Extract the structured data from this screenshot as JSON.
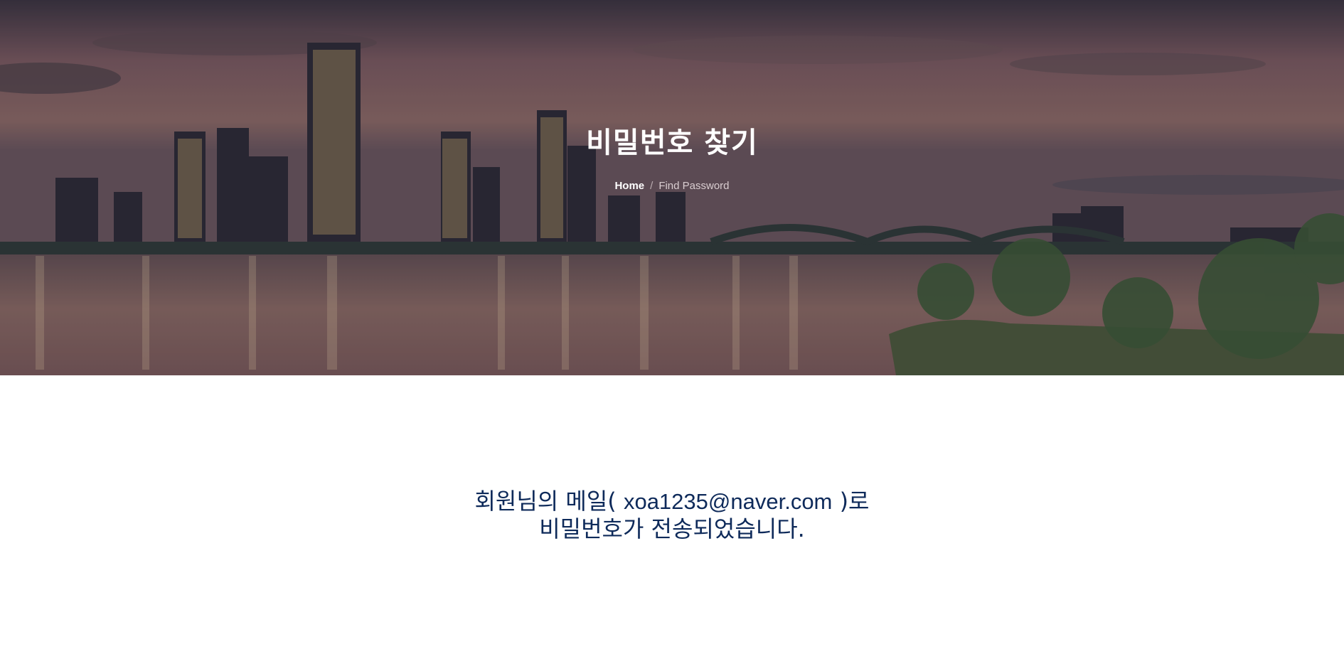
{
  "hero": {
    "title": "비밀번호 찾기",
    "breadcrumb": {
      "home": "Home",
      "separator": "/",
      "current": "Find Password"
    }
  },
  "message": {
    "line1_prefix": "회원님의 메일( ",
    "email": "xoa1235@naver.com",
    "line1_suffix": " )로",
    "line2": "비밀번호가 전송되었습니다."
  },
  "colors": {
    "title": "#ffffff",
    "message_text": "#0e2a5a",
    "background": "#ffffff"
  }
}
